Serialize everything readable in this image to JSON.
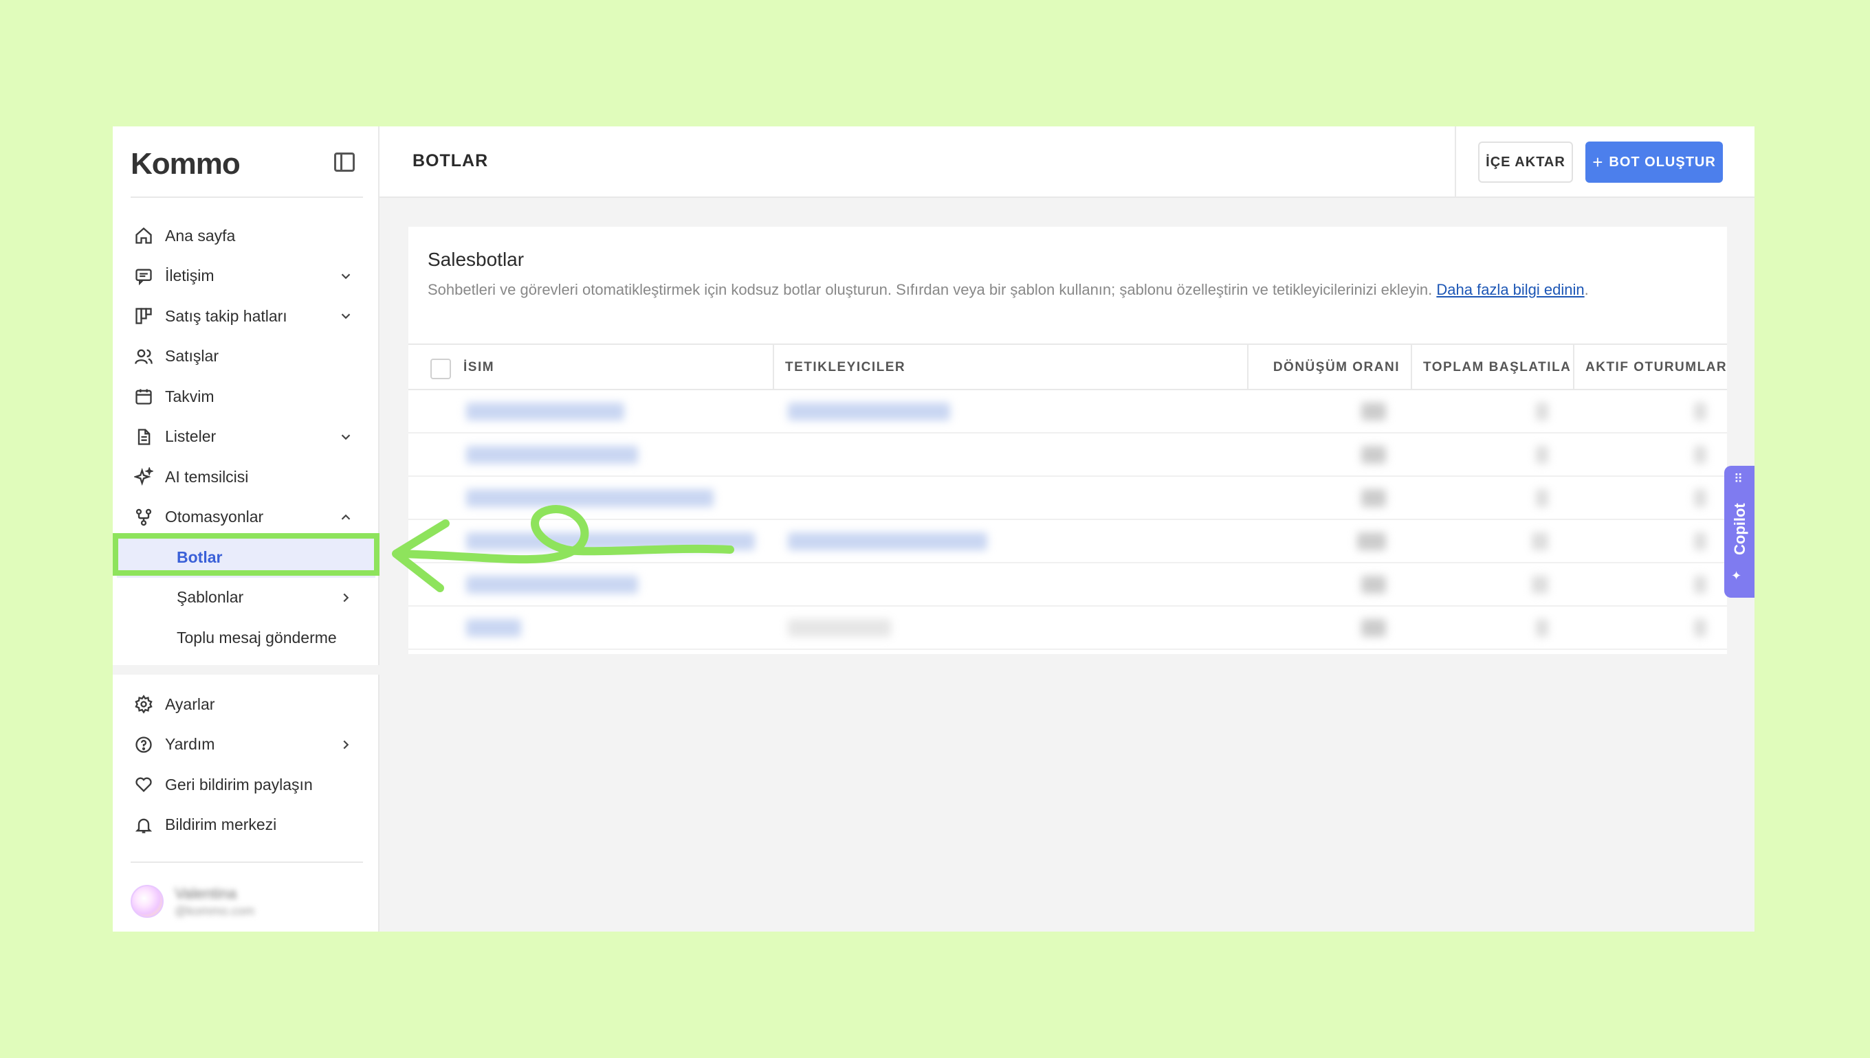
{
  "app": {
    "logo": "Kommo"
  },
  "sidebar": {
    "items": [
      {
        "label": "Ana sayfa",
        "icon": "home-icon"
      },
      {
        "label": "İletişim",
        "icon": "chat-icon",
        "chevron": "down"
      },
      {
        "label": "Satış takip hatları",
        "icon": "pipeline-icon",
        "chevron": "down"
      },
      {
        "label": "Satışlar",
        "icon": "users-icon"
      },
      {
        "label": "Takvim",
        "icon": "calendar-icon"
      },
      {
        "label": "Listeler",
        "icon": "document-icon",
        "chevron": "down"
      },
      {
        "label": "AI temsilcisi",
        "icon": "sparkles-icon"
      },
      {
        "label": "Otomasyonlar",
        "icon": "automation-icon",
        "chevron": "up"
      }
    ],
    "subitems": [
      {
        "label": "Botlar",
        "active": true
      },
      {
        "label": "Şablonlar",
        "chevron": "right"
      },
      {
        "label": "Toplu mesaj gönderme"
      }
    ],
    "bottom_items": [
      {
        "label": "Ayarlar",
        "icon": "gear-icon"
      },
      {
        "label": "Yardım",
        "icon": "help-icon",
        "chevron": "right"
      },
      {
        "label": "Geri bildirim paylaşın",
        "icon": "heart-icon"
      },
      {
        "label": "Bildirim merkezi",
        "icon": "bell-icon"
      }
    ],
    "user": {
      "name": "Valentina",
      "subtitle": "@kommo.com"
    }
  },
  "header": {
    "title": "BOTLAR",
    "import_label": "İÇE AKTAR",
    "create_label": "BOT OLUŞTUR"
  },
  "card": {
    "title": "Salesbotlar",
    "description": "Sohbetleri ve görevleri otomatikleştirmek için kodsuz botlar oluşturun. Sıfırdan veya bir şablon kullanın; şablonu özelleştirin ve tetikleyicilerinizi ekleyin. ",
    "link_text": "Daha fazla bilgi edinin",
    "link_suffix": "."
  },
  "table": {
    "columns": [
      "İSIM",
      "TETIKLEYICILER",
      "DÖNÜŞÜM ORANI",
      "TOPLAM BAŞLATILA",
      "AKTIF OTURUMLAR"
    ]
  },
  "copilot": {
    "label": "Copilot"
  },
  "colors": {
    "accent": "#4c7fec",
    "highlight": "#8ee35c",
    "background": "#e0fcbb",
    "copilot": "#7f7bf0"
  }
}
